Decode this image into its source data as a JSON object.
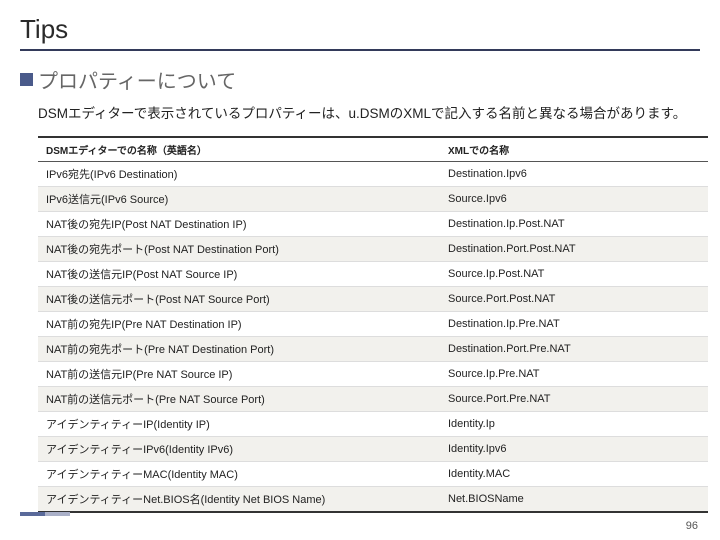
{
  "title": "Tips",
  "section_title": "プロパティーについて",
  "description": "DSMエディターで表示されているプロパティーは、u.DSMのXMLで記入する名前と異なる場合があります。",
  "table": {
    "header_left": "DSMエディターでの名称（英語名）",
    "header_right": "XMLでの名称",
    "rows": [
      {
        "left": "IPv6宛先(IPv6 Destination)",
        "right": "Destination.Ipv6"
      },
      {
        "left": "IPv6送信元(IPv6 Source)",
        "right": "Source.Ipv6"
      },
      {
        "left": "NAT後の宛先IP(Post NAT Destination IP)",
        "right": "Destination.Ip.Post.NAT"
      },
      {
        "left": "NAT後の宛先ポート(Post NAT Destination Port)",
        "right": "Destination.Port.Post.NAT"
      },
      {
        "left": "NAT後の送信元IP(Post NAT Source IP)",
        "right": "Source.Ip.Post.NAT"
      },
      {
        "left": "NAT後の送信元ポート(Post NAT Source Port)",
        "right": "Source.Port.Post.NAT"
      },
      {
        "left": "NAT前の宛先IP(Pre NAT Destination IP)",
        "right": "Destination.Ip.Pre.NAT"
      },
      {
        "left": "NAT前の宛先ポート(Pre NAT Destination Port)",
        "right": "Destination.Port.Pre.NAT"
      },
      {
        "left": "NAT前の送信元IP(Pre NAT Source IP)",
        "right": "Source.Ip.Pre.NAT"
      },
      {
        "left": "NAT前の送信元ポート(Pre NAT Source Port)",
        "right": "Source.Port.Pre.NAT"
      },
      {
        "left": "アイデンティティーIP(Identity IP)",
        "right": "Identity.Ip"
      },
      {
        "left": "アイデンティティーIPv6(Identity IPv6)",
        "right": "Identity.Ipv6"
      },
      {
        "left": "アイデンティティーMAC(Identity MAC)",
        "right": "Identity.MAC"
      },
      {
        "left": "アイデンティティーNet.BIOS名(Identity Net BIOS Name)",
        "right": "Net.BIOSName"
      }
    ]
  },
  "page_number": "96"
}
